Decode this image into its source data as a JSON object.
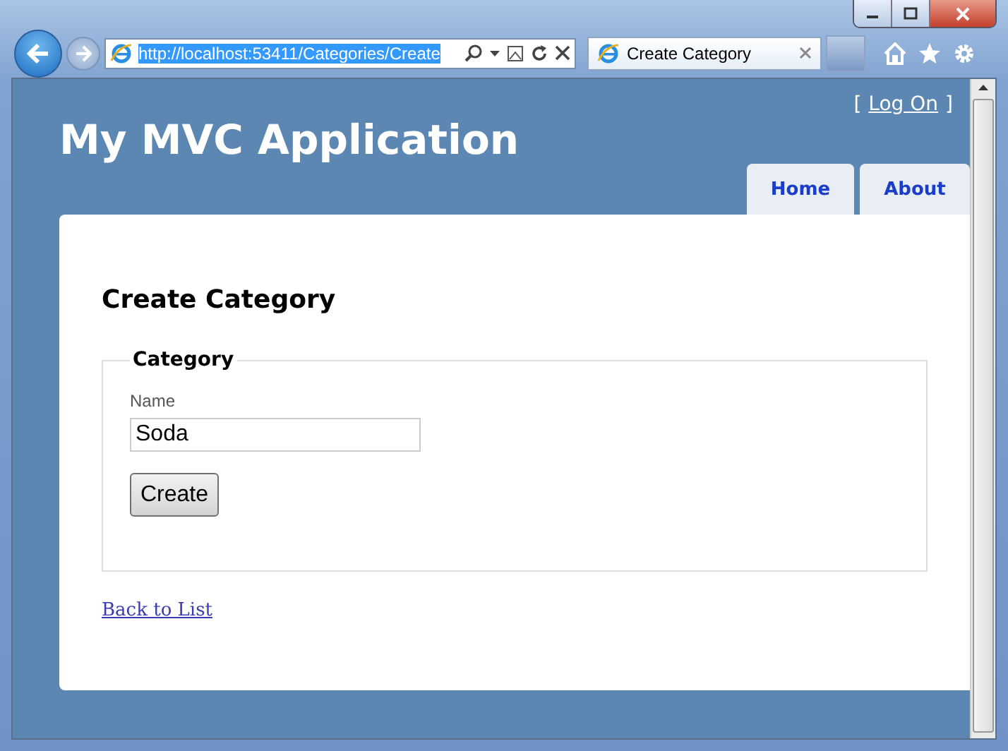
{
  "browser": {
    "address": {
      "value": "http://localhost:53411/Categories/Create",
      "selected": true
    },
    "tab": {
      "title": "Create Category",
      "selected": true
    }
  },
  "site": {
    "title": "My MVC Application",
    "login": {
      "open": "[",
      "link": "Log On",
      "close": "]"
    },
    "menu": [
      {
        "label": "Home"
      },
      {
        "label": "About"
      }
    ]
  },
  "page": {
    "heading": "Create Category",
    "fieldset": {
      "legend": "Category",
      "fields": [
        {
          "label": "Name",
          "value": "Soda"
        }
      ]
    },
    "submit": "Create",
    "back_link": "Back to List"
  }
}
